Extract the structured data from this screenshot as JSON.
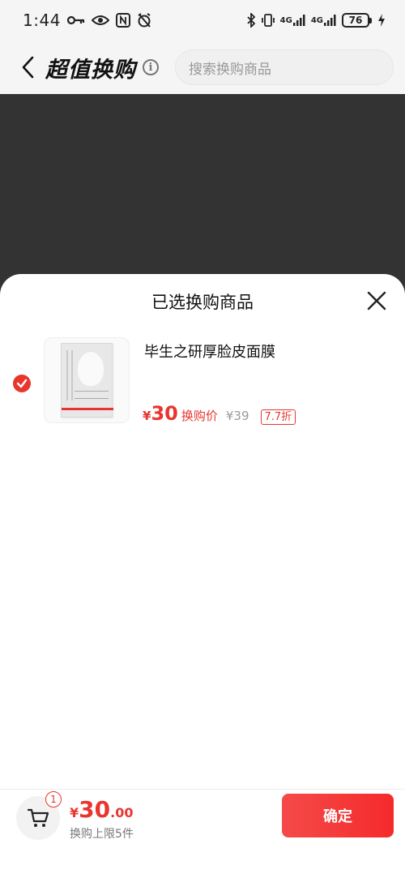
{
  "status_bar": {
    "time": "1:44",
    "network_1": "4G",
    "network_2": "4G",
    "battery": "76"
  },
  "header": {
    "title": "超值换购",
    "search_placeholder": "搜索换购商品"
  },
  "sheet": {
    "title": "已选换购商品",
    "items": [
      {
        "name": "毕生之研厚脸皮面膜",
        "currency": "¥",
        "price": "30",
        "price_label": "换购价",
        "original_price": "¥39",
        "discount": "7.7折",
        "selected": true
      }
    ]
  },
  "bottom_bar": {
    "cart_count": "1",
    "total_currency": "¥",
    "total_integer": "30",
    "total_decimal": ".00",
    "limit_text": "换购上限5件",
    "confirm_label": "确定"
  },
  "colors": {
    "accent": "#e8362f",
    "overlay": "#333333"
  }
}
